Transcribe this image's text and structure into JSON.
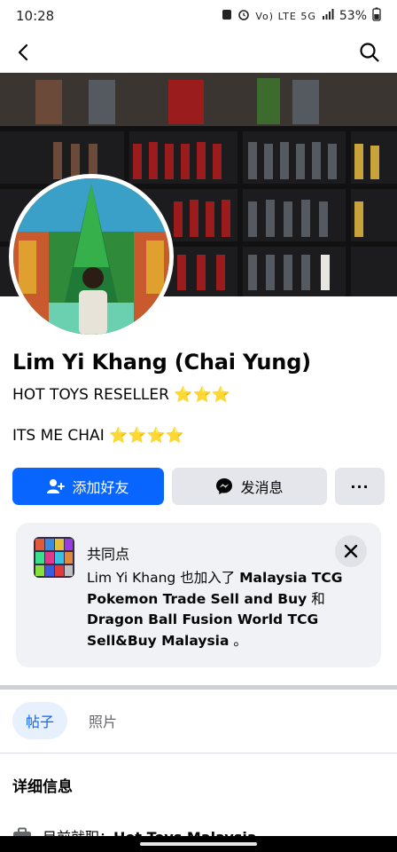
{
  "status_bar": {
    "time": "10:28",
    "indicators": "Vo) LTE 5G",
    "battery": "53%"
  },
  "profile": {
    "name": "Lim Yi Khang (Chai Yung)",
    "bio_line1": "HOT TOYS RESELLER ⭐⭐⭐",
    "bio_line2": "ITS ME CHAI ⭐⭐⭐⭐"
  },
  "actions": {
    "add_friend_label": "添加好友",
    "message_label": "发消息",
    "more_label": "···"
  },
  "mutual_card": {
    "title": "共同点",
    "prefix": "Lim Yi Khang 也加入了 ",
    "group1": "Malaysia TCG Pokemon Trade Sell and Buy",
    "connector": " 和 ",
    "group2": "Dragon Ball Fusion World TCG Sell&Buy Malaysia",
    "suffix": " 。"
  },
  "tabs": {
    "posts": "帖子",
    "photos": "照片"
  },
  "details": {
    "title": "详细信息",
    "job_label": "目前就职：",
    "job_value": "Hot Toys Malaysia"
  },
  "colors": {
    "primary": "#0866ff",
    "secondary_button": "#e4e6eb",
    "card_bg": "#f0f2f5"
  },
  "icons": {
    "back": "back-arrow-icon",
    "search": "search-icon",
    "add_friend": "add-person-icon",
    "messenger": "messenger-icon",
    "close": "close-icon",
    "job": "briefcase-icon"
  }
}
